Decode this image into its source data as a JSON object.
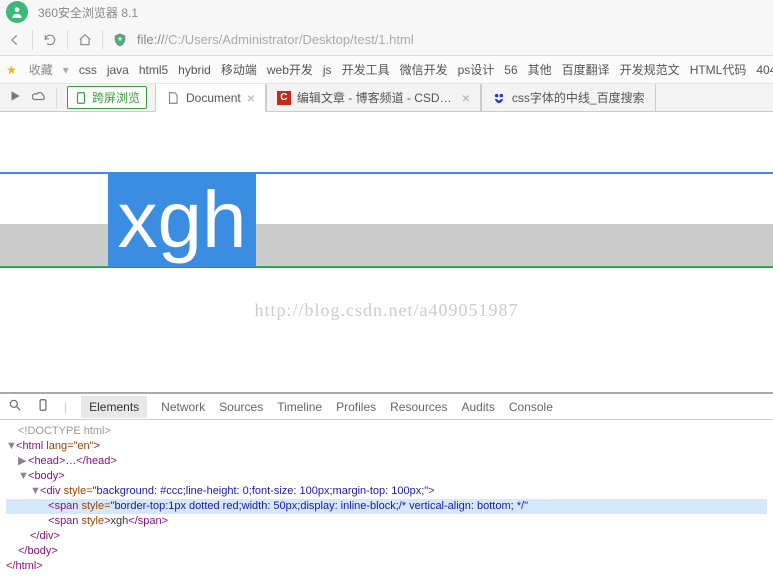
{
  "title": "360安全浏览器 8.1",
  "address": {
    "scheme": "file://",
    "path": "/C:/Users/Administrator/Desktop/test/1.html"
  },
  "bookmarks": {
    "label": "收藏",
    "items": [
      "css",
      "java",
      "html5",
      "hybrid",
      "移动端",
      "web开发",
      "js",
      "开发工具",
      "微信开发",
      "ps设计",
      "56",
      "其他",
      "百度翻译",
      "开发规范文",
      "HTML代码",
      "404"
    ]
  },
  "cross_screen": "跨屏浏览",
  "tabs": [
    {
      "label": "Document",
      "active": true
    },
    {
      "label": "编辑文章 - 博客频道 - CSDN.N"
    },
    {
      "label": "css字体的中线_百度搜索"
    }
  ],
  "rendered": {
    "text": "xgh",
    "watermark": "http://blog.csdn.net/a409051987"
  },
  "devtools": {
    "tabs": [
      "Elements",
      "Network",
      "Sources",
      "Timeline",
      "Profiles",
      "Resources",
      "Audits",
      "Console"
    ],
    "active_tab": "Elements",
    "dom": {
      "doctype": "<!DOCTYPE html>",
      "html_open": "html",
      "html_attr": "lang=\"en\"",
      "head": "head",
      "head_ellipsis": "…",
      "body": "body",
      "div": "div",
      "div_style": "background: #ccc;line-height: 0;font-size: 100px;margin-top: 100px;",
      "span1": "span",
      "span1_style": "border-top:1px dotted red;width: 50px;display: inline-block;/* vertical-align: bottom; */",
      "span2": "span",
      "span2_text": "xgh"
    }
  }
}
